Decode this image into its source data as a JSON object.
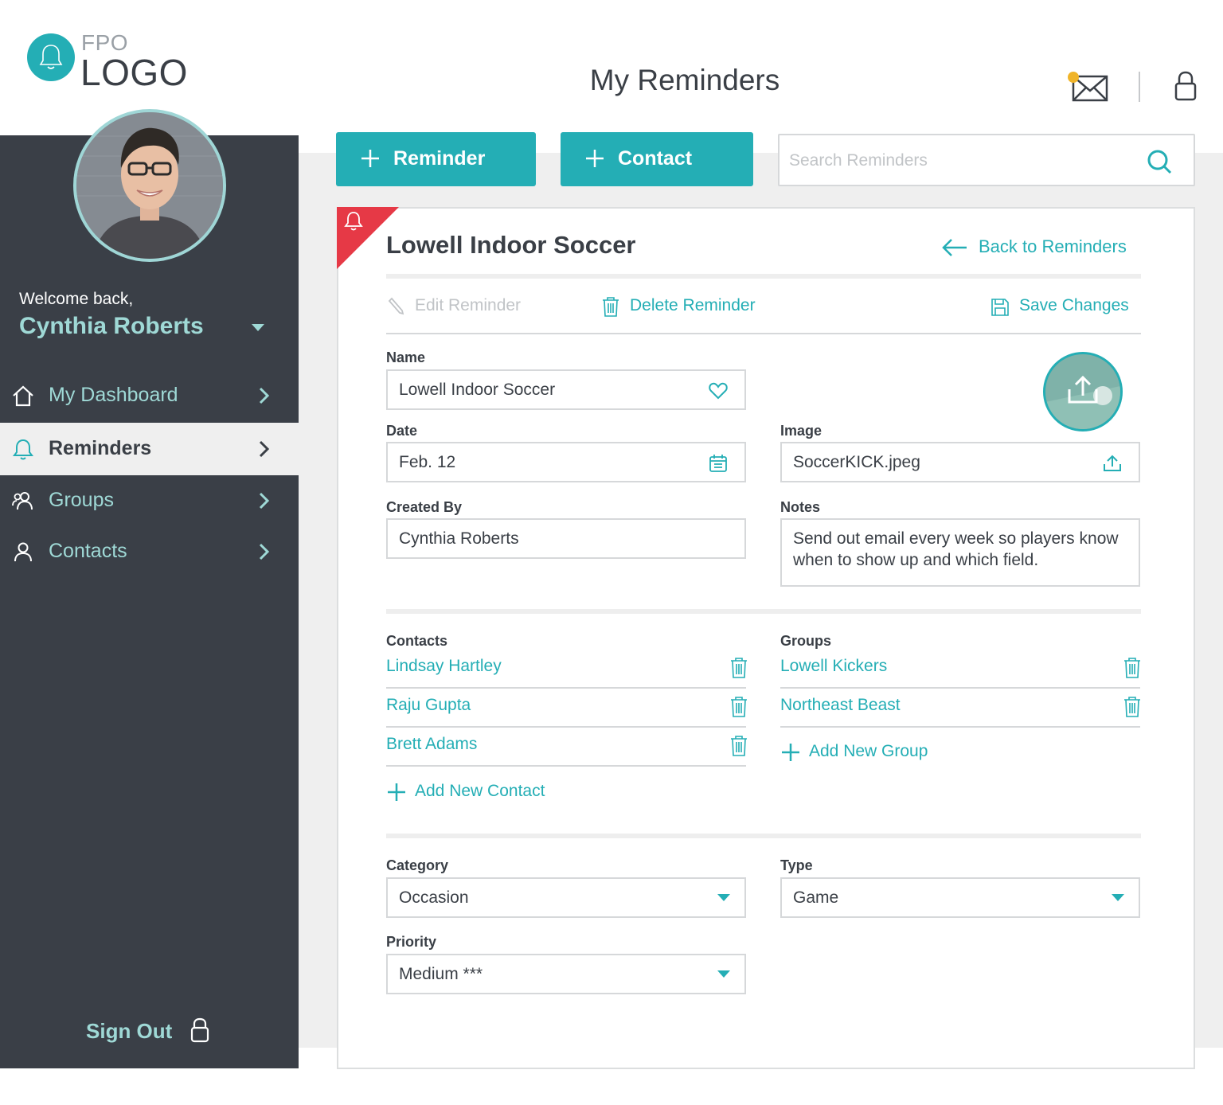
{
  "brand": {
    "logo_top": "FPO",
    "logo_bottom": "LOGO"
  },
  "header": {
    "title": "My Reminders"
  },
  "colors": {
    "accent": "#24aeb5",
    "sidebar": "#3a3f47",
    "notification": "#f0b429",
    "alert": "#e63946"
  },
  "user": {
    "welcome": "Welcome back,",
    "name": "Cynthia Roberts"
  },
  "nav": {
    "items": [
      {
        "label": "My Dashboard",
        "icon": "home-icon"
      },
      {
        "label": "Reminders",
        "icon": "bell-icon"
      },
      {
        "label": "Groups",
        "icon": "groups-icon"
      },
      {
        "label": "Contacts",
        "icon": "person-icon"
      }
    ],
    "sign_out": "Sign Out"
  },
  "toolbar": {
    "add_reminder": "Reminder",
    "add_contact": "Contact",
    "search_placeholder": "Search Reminders"
  },
  "card": {
    "title": "Lowell Indoor Soccer",
    "back_label": "Back to Reminders",
    "edit_label": "Edit Reminder",
    "delete_label": "Delete Reminder",
    "save_label": "Save Changes"
  },
  "form": {
    "name": {
      "label": "Name",
      "value": "Lowell Indoor Soccer"
    },
    "date": {
      "label": "Date",
      "value": "Feb. 12"
    },
    "image": {
      "label": "Image",
      "value": "SoccerKICK.jpeg"
    },
    "created_by": {
      "label": "Created By",
      "value": "Cynthia Roberts"
    },
    "notes": {
      "label": "Notes",
      "value": "Send out email every week so players know when to show up and which field."
    },
    "category": {
      "label": "Category",
      "value": "Occasion"
    },
    "type": {
      "label": "Type",
      "value": "Game"
    },
    "priority": {
      "label": "Priority",
      "value": "Medium ***"
    }
  },
  "contacts": {
    "label": "Contacts",
    "items": [
      "Lindsay Hartley",
      "Raju Gupta",
      "Brett Adams"
    ],
    "add_label": "Add New Contact"
  },
  "groups": {
    "label": "Groups",
    "items": [
      "Lowell Kickers",
      "Northeast Beast"
    ],
    "add_label": "Add New Group"
  }
}
